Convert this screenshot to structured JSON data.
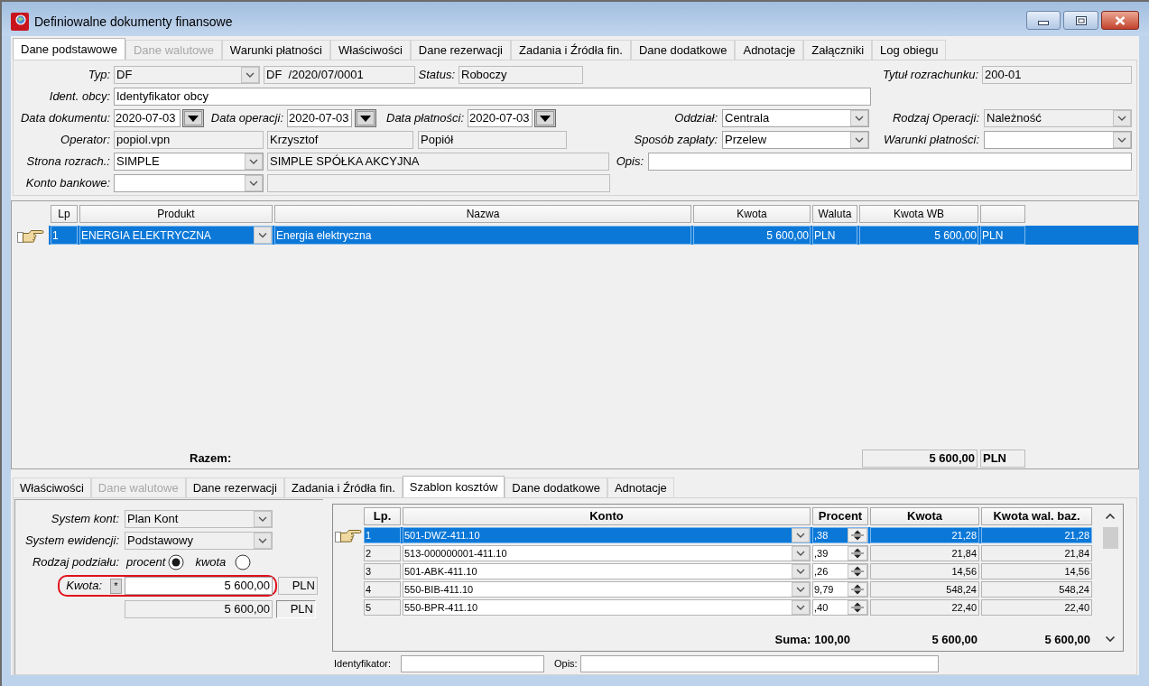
{
  "window": {
    "title": "Definiowalne dokumenty finansowe"
  },
  "tabs": [
    {
      "label": "Dane podstawowe",
      "selected": true,
      "disabled": false
    },
    {
      "label": "Dane walutowe",
      "selected": false,
      "disabled": true
    },
    {
      "label": "Warunki płatności",
      "selected": false,
      "disabled": false
    },
    {
      "label": "Właściwości",
      "selected": false,
      "disabled": false
    },
    {
      "label": "Dane rezerwacji",
      "selected": false,
      "disabled": false
    },
    {
      "label": "Zadania i Źródła fin.",
      "selected": false,
      "disabled": false
    },
    {
      "label": "Dane dodatkowe",
      "selected": false,
      "disabled": false
    },
    {
      "label": "Adnotacje",
      "selected": false,
      "disabled": false
    },
    {
      "label": "Załączniki",
      "selected": false,
      "disabled": false
    },
    {
      "label": "Log obiegu",
      "selected": false,
      "disabled": false
    }
  ],
  "form": {
    "typ": {
      "label": "Typ:",
      "value": "DF",
      "readonly": true
    },
    "numer": {
      "value": "DF  /2020/07/0001",
      "readonly": true
    },
    "status": {
      "label": "Status:",
      "value": "Roboczy",
      "readonly": true
    },
    "tytul_rozrachunku": {
      "label": "Tytuł rozrachunku:",
      "value": "200-01",
      "readonly": true
    },
    "ident_obcy": {
      "label": "Ident. obcy:",
      "value": "Identyfikator obcy",
      "readonly": false
    },
    "data_dokumentu": {
      "label": "Data dokumentu:",
      "value": "2020-07-03",
      "readonly": false
    },
    "data_operacji": {
      "label": "Data operacji:",
      "value": "2020-07-03",
      "readonly": false
    },
    "data_platnosci": {
      "label": "Data płatności:",
      "value": "2020-07-03",
      "readonly": false
    },
    "oddzial": {
      "label": "Oddział:",
      "value": "Centrala",
      "readonly": false
    },
    "rodzaj_operacji": {
      "label": "Rodzaj Operacji:",
      "value": "Należność",
      "readonly": true
    },
    "operator": {
      "label": "Operator:",
      "fields": [
        {
          "value": "popiol.vpn",
          "readonly": true
        },
        {
          "value": "Krzysztof",
          "readonly": true
        },
        {
          "value": "Popiół",
          "readonly": true
        }
      ]
    },
    "sposob_zaplaty": {
      "label": "Sposób zapłaty:",
      "value": "Przelew",
      "readonly": false
    },
    "warunki_platnosci": {
      "label": "Warunki płatności:",
      "readonly": false
    },
    "strona_rozrach": {
      "label": "Strona rozrach.:",
      "code": {
        "value": "SIMPLE",
        "readonly": false
      },
      "name": {
        "value": "SIMPLE SPÓŁKA AKCYJNA",
        "readonly": true
      }
    },
    "opis": {
      "label": "Opis:",
      "readonly": false
    },
    "konto_bankowe": {
      "label": "Konto bankowe:",
      "account": {
        "readonly": false
      },
      "details": {
        "readonly": true
      }
    }
  },
  "products_table": {
    "columns": [
      "Lp",
      "Produkt",
      "Nazwa",
      "Kwota",
      "Waluta",
      "Kwota WB"
    ],
    "rows": [
      {
        "selected": true,
        "lp": "1",
        "produkt": "ENERGIA ELEKTRYCZNA",
        "nazwa": "Energia elektryczna",
        "kwota": "5 600,00",
        "waluta": "PLN",
        "kwota_wb": "5 600,00",
        "column_7": "PLN"
      }
    ],
    "total": {
      "label": "Razem:",
      "kwota_wb": "5 600,00",
      "waluta": "PLN"
    }
  },
  "detail_tabs": [
    {
      "label": "Właściwości",
      "selected": false,
      "disabled": false
    },
    {
      "label": "Dane walutowe",
      "selected": false,
      "disabled": true
    },
    {
      "label": "Dane rezerwacji",
      "selected": false,
      "disabled": false
    },
    {
      "label": "Zadania i Źródła fin.",
      "selected": false,
      "disabled": false
    },
    {
      "label": "Szablon kosztów",
      "selected": true,
      "disabled": false
    },
    {
      "label": "Dane dodatkowe",
      "selected": false,
      "disabled": false
    },
    {
      "label": "Adnotacje",
      "selected": false,
      "disabled": false
    }
  ],
  "cost_template": {
    "system_kont": {
      "label": "System kont:",
      "value": "Plan Kont",
      "readonly": true
    },
    "system_ewidencji": {
      "label": "System ewidencji:",
      "value": "Podstawowy",
      "readonly": true
    },
    "rodzaj_podzialu": {
      "label": "Rodzaj podziału:",
      "options": [
        {
          "label": "procent",
          "selected": true
        },
        {
          "label": "kwota",
          "selected": false
        }
      ]
    },
    "kwota": {
      "label": "Kwota:",
      "button": "*",
      "value": "5 600,00",
      "currency": "PLN",
      "highlighted": true
    },
    "kwota_bazowa": {
      "value": "5 600,00",
      "currency": "PLN"
    },
    "table": {
      "columns": [
        "Lp.",
        "Konto",
        "Procent",
        "Kwota",
        "Kwota wal. baz."
      ],
      "rows": [
        {
          "selected": true,
          "lp": "1",
          "konto": "501-DWZ-411.10",
          "procent": ",38",
          "kwota": "21,28",
          "kwota_wal_baz": "21,28"
        },
        {
          "selected": false,
          "lp": "2",
          "konto": "513-000000001-411.10",
          "procent": ",39",
          "kwota": "21,84",
          "kwota_wal_baz": "21,84"
        },
        {
          "selected": false,
          "lp": "3",
          "konto": "501-ABK-411.10",
          "procent": ",26",
          "kwota": "14,56",
          "kwota_wal_baz": "14,56"
        },
        {
          "selected": false,
          "lp": "4",
          "konto": "550-BIB-411.10",
          "procent": "9,79",
          "kwota": "548,24",
          "kwota_wal_baz": "548,24"
        },
        {
          "selected": false,
          "lp": "5",
          "konto": "550-BPR-411.10",
          "procent": ",40",
          "kwota": "22,40",
          "kwota_wal_baz": "22,40"
        }
      ],
      "sum": {
        "label": "Suma:",
        "procent": "100,00",
        "kwota": "5 600,00",
        "kwota_wal_baz": "5 600,00"
      }
    },
    "identyfikator": {
      "label": "Identyfikator:"
    },
    "opis": {
      "label": "Opis:"
    }
  }
}
